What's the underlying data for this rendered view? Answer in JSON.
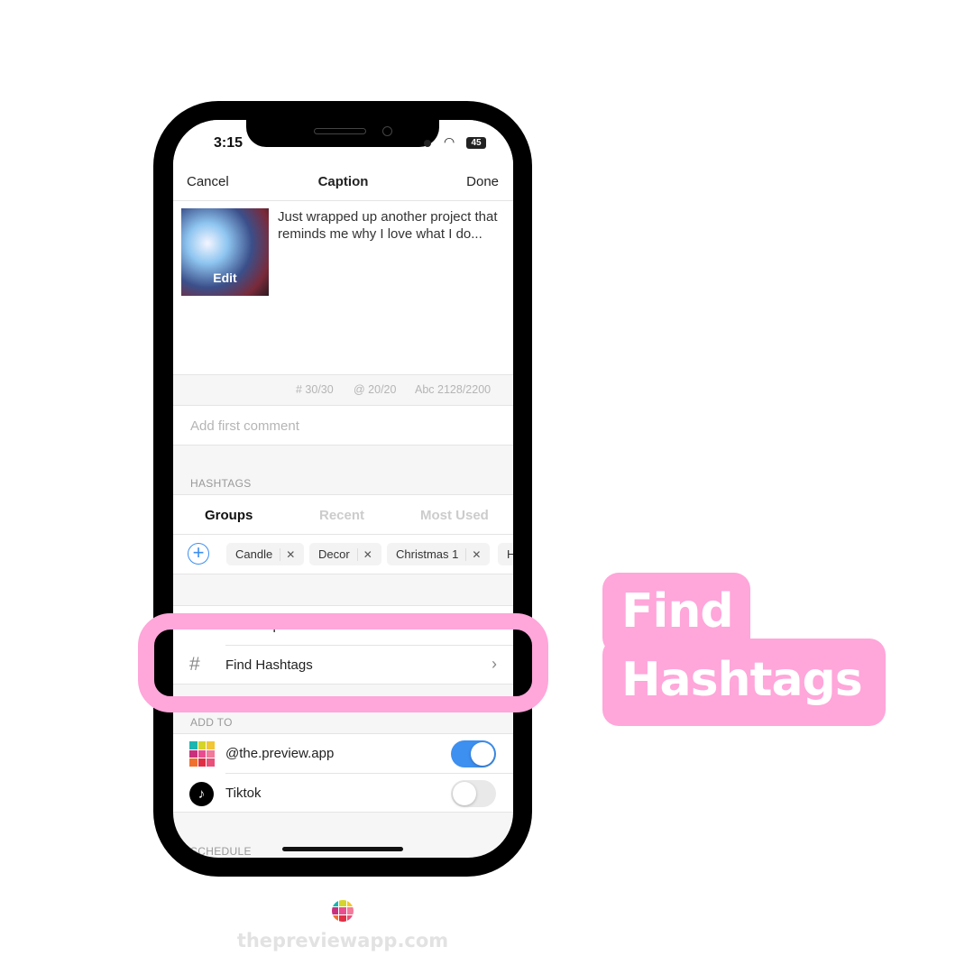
{
  "status_bar": {
    "time": "3:15",
    "battery": "45"
  },
  "nav": {
    "cancel": "Cancel",
    "title": "Caption",
    "done": "Done"
  },
  "post": {
    "edit_label": "Edit",
    "caption": "Just wrapped up another project that reminds me why I love what I do..."
  },
  "counters": {
    "hashtags": "# 30/30",
    "mentions": "@ 20/20",
    "chars": "Abc 2128/2200"
  },
  "comment": {
    "placeholder": "Add first comment"
  },
  "hashtags": {
    "section": "HASHTAGS",
    "tabs": [
      {
        "label": "Groups",
        "active": true
      },
      {
        "label": "Recent",
        "active": false
      },
      {
        "label": "Most Used",
        "active": false
      }
    ],
    "chips": [
      "Candle",
      "Decor",
      "Christmas 1",
      "H"
    ]
  },
  "tools": {
    "find_captions": "Find Captions",
    "find_hashtags": "Find Hashtags"
  },
  "add_to": {
    "section": "ADD TO",
    "accounts": [
      {
        "name": "@the.preview.app",
        "enabled": true,
        "icon": "preview-app-icon"
      },
      {
        "name": "Tiktok",
        "enabled": false,
        "icon": "tiktok-icon"
      }
    ]
  },
  "schedule": {
    "section": "SCHEDULE"
  },
  "callout": {
    "line1": "Find",
    "line2": "Hashtags"
  },
  "footer": {
    "site": "thepreviewapp.com"
  },
  "colors": {
    "accent": "#3d8ff0",
    "highlight": "#ffa6da"
  }
}
